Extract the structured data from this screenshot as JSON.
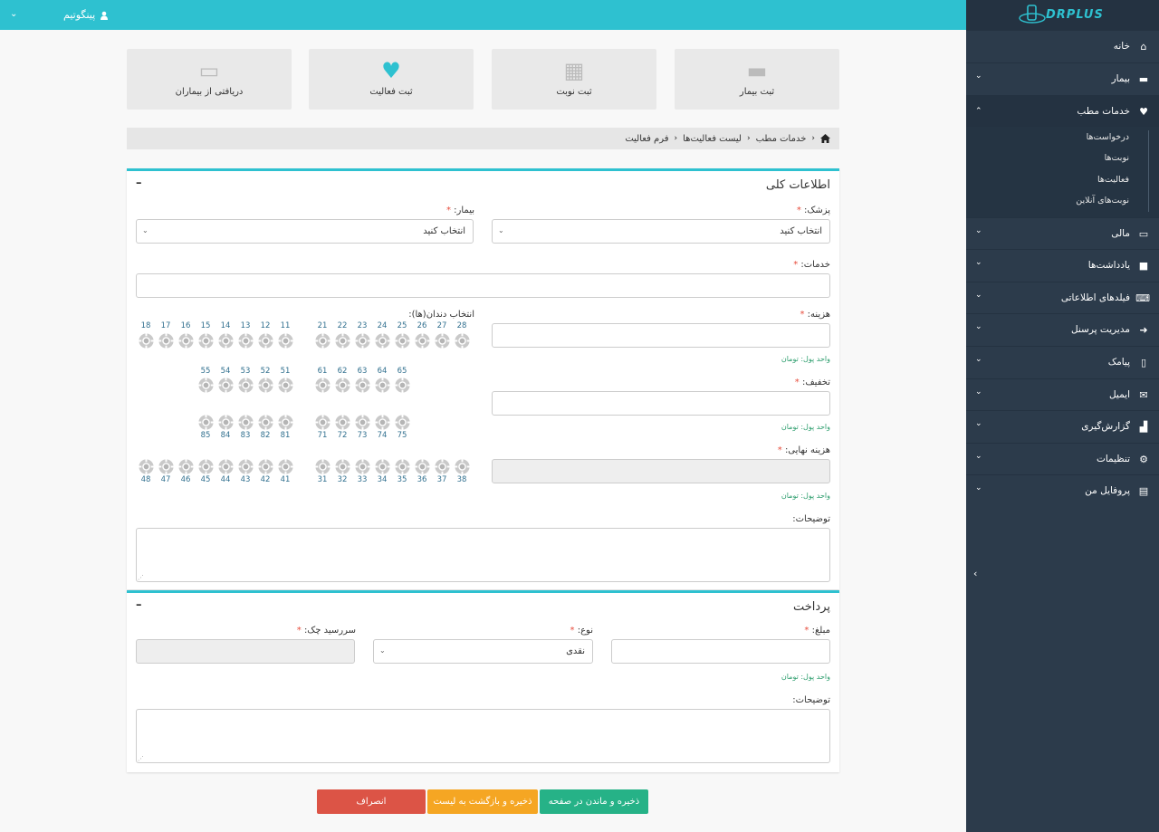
{
  "header": {
    "user_name": "پینگوتیم"
  },
  "sidebar": {
    "logo_text": "DRPLUS",
    "items": [
      {
        "label": "خانه",
        "icon": "home-icon",
        "glyph": "⌂",
        "chevron": ""
      },
      {
        "label": "بیمار",
        "icon": "bed-icon",
        "glyph": "▬",
        "chevron": "⌄"
      },
      {
        "label": "خدمات مطب",
        "icon": "tooth-icon",
        "glyph": "♥",
        "chevron": "⌃"
      },
      {
        "label": "مالی",
        "icon": "credit-card-icon",
        "glyph": "▭",
        "chevron": "⌄"
      },
      {
        "label": "یادداشت‌ها",
        "icon": "note-icon",
        "glyph": "■",
        "chevron": "⌄"
      },
      {
        "label": "فیلدهای اطلاعاتی",
        "icon": "keyboard-icon",
        "glyph": "⌨",
        "chevron": "⌄"
      },
      {
        "label": "مدیریت پرسنل",
        "icon": "sign-in-icon",
        "glyph": "➜",
        "chevron": "⌄"
      },
      {
        "label": "پیامک",
        "icon": "mobile-icon",
        "glyph": "▯",
        "chevron": "⌄"
      },
      {
        "label": "ایمیل",
        "icon": "envelope-icon",
        "glyph": "✉",
        "chevron": "⌄"
      },
      {
        "label": "گزارش‌گیری",
        "icon": "bar-chart-icon",
        "glyph": "▟",
        "chevron": "⌄"
      },
      {
        "label": "تنظیمات",
        "icon": "cogs-icon",
        "glyph": "⚙",
        "chevron": "⌄"
      },
      {
        "label": "پروفایل من",
        "icon": "id-card-icon",
        "glyph": "▤",
        "chevron": "⌄"
      }
    ],
    "submenu": [
      "درخواست‌ها",
      "نوبت‌ها",
      "فعالیت‌ها",
      "نوبت‌های آنلاین"
    ]
  },
  "quick_actions": [
    {
      "label": "ثبت بیمار",
      "icon": "bed-icon"
    },
    {
      "label": "ثبت نوبت",
      "icon": "calendar-check-icon"
    },
    {
      "label": "ثبت فعالیت",
      "icon": "tooth-icon"
    },
    {
      "label": "دریافتی از بیماران",
      "icon": "credit-card-icon"
    }
  ],
  "breadcrumb": [
    "خدمات مطب",
    "لیست فعالیت‌ها",
    "فرم فعالیت"
  ],
  "general": {
    "title": "اطلاعات کلی",
    "doctor_label": "پزشک:",
    "doctor_value": "انتخاب کنید",
    "patient_label": "بیمار:",
    "patient_value": "انتخاب کنید",
    "services_label": "خدمات:",
    "cost_label": "هزینه:",
    "discount_label": "تخفیف:",
    "final_cost_label": "هزینه نهایی:",
    "currency_hint": "واحد پول: تومان",
    "teeth_label": "انتخاب دندان(ها):",
    "notes_label": "توضیحات:",
    "teeth": {
      "upper_permanent_right": [
        "18",
        "17",
        "16",
        "15",
        "14",
        "13",
        "12",
        "11"
      ],
      "upper_permanent_left": [
        "21",
        "22",
        "23",
        "24",
        "25",
        "26",
        "27",
        "28"
      ],
      "upper_primary_right": [
        "55",
        "54",
        "53",
        "52",
        "51"
      ],
      "upper_primary_left": [
        "61",
        "62",
        "63",
        "64",
        "65"
      ],
      "lower_primary_right": [
        "85",
        "84",
        "83",
        "82",
        "81"
      ],
      "lower_primary_left": [
        "71",
        "72",
        "73",
        "74",
        "75"
      ],
      "lower_permanent_right": [
        "48",
        "47",
        "46",
        "45",
        "44",
        "43",
        "42",
        "41"
      ],
      "lower_permanent_left": [
        "31",
        "32",
        "33",
        "34",
        "35",
        "36",
        "37",
        "38"
      ]
    }
  },
  "payment": {
    "title": "پرداخت",
    "amount_label": "مبلغ:",
    "type_label": "نوع:",
    "type_value": "نقدی",
    "due_label": "سررسید چک:",
    "currency_hint": "واحد پول: تومان",
    "notes_label": "توضیحات:"
  },
  "actions": {
    "save_stay": "ذخیره و ماندن در صفحه",
    "save_back": "ذخیره و بازگشت به لیست",
    "cancel": "انصراف"
  },
  "colors": {
    "accent": "#2ec1d0",
    "sidebar": "#2c3b4b",
    "success": "#26b287",
    "warning": "#f5a623",
    "danger": "#dc5446"
  }
}
